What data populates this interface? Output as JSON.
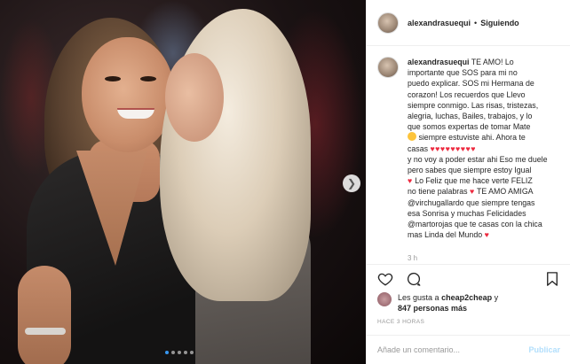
{
  "post": {
    "username": "alexandrasuequi",
    "follow_status": "Siguiendo",
    "separator": "•"
  },
  "caption": {
    "username": "alexandrasuequi",
    "lines": [
      "TE AMO! Lo",
      "importante que SOS para mi no",
      "puedo explicar. SOS mi Hermana de",
      "corazon! Los recuerdos que Llevo",
      "siempre conmigo. Las risas, tristezas,",
      "alegria, luchas, Bailes, trabajos, y lo",
      "que somos expertas de tomar Mate"
    ],
    "line_emoji": "siempre estuviste ahi. Ahora te",
    "line_casas": "casas",
    "hearts": "♥♥♥♥♥♥♥♥♥",
    "lines_2": [
      "y no voy a poder estar ahi Eso me duele",
      "pero sabes que siempre estoy Igual"
    ],
    "line_feliz": "Lo Feliz que me hace verte FELIZ",
    "line_palabras_a": "no tiene palabras",
    "line_palabras_b": "TE AMO AMIGA",
    "mention_1": "@virchugallardo",
    "line_mention_1": " que siempre tengas",
    "line_sonrisa": "esa Sonrisa y muchas Felicidades",
    "mention_2": "@martorojas",
    "line_mention_2": " que te casas con la chica",
    "line_final": "mas Linda del Mundo",
    "time": "3 h"
  },
  "likes": {
    "prefix": "Les gusta a",
    "user": "cheap2cheap",
    "conjunction": "y",
    "count_text": "847 personas más"
  },
  "post_age": "HACE 3 HORAS",
  "comment": {
    "placeholder": "Añade un comentario...",
    "publish": "Publicar"
  },
  "carousel": {
    "slides": 5,
    "active_index": 0
  },
  "icons": {
    "like": "heart-icon",
    "comment": "comment-icon",
    "save": "bookmark-icon",
    "next": "chevron-right-icon"
  },
  "colors": {
    "accent": "#3897f0",
    "heart": "#ed2a3f",
    "publish_disabled": "#b2dffc"
  }
}
